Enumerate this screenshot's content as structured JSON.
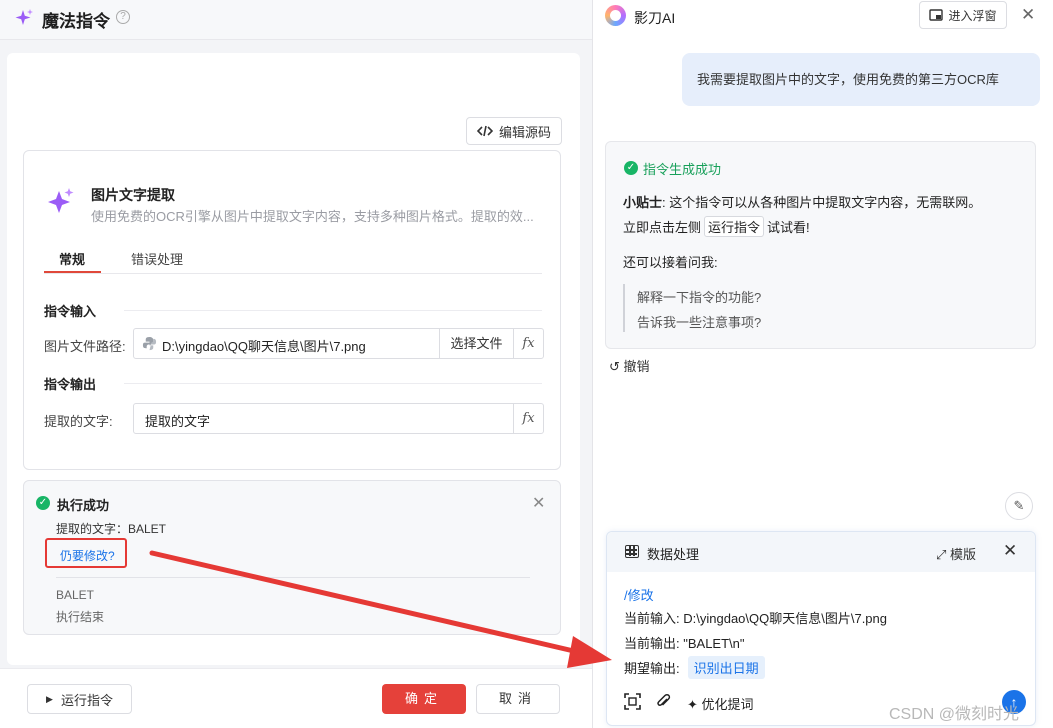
{
  "left": {
    "title": "魔法指令",
    "help_icon": "?",
    "edit_source_label": "编辑源码",
    "card": {
      "title": "图片文字提取",
      "desc": "使用免费的OCR引擎从图片中提取文字内容，支持多种图片格式。提取的效...",
      "tabs": [
        "常规",
        "错误处理"
      ],
      "active_tab": "常规",
      "input_section": "指令输入",
      "input_label": "图片文件路径:",
      "input_value": "D:\\yingdao\\QQ聊天信息\\图片\\7.png",
      "pick_file": "选择文件",
      "fx": "fx",
      "output_section": "指令输出",
      "output_label": "提取的文字:",
      "output_value": "提取的文字"
    },
    "result": {
      "title": "执行成功",
      "line1": "提取的文字：BALET",
      "modify_link": "仍要修改?",
      "log1": "BALET",
      "log2": "执行结束"
    },
    "footer": {
      "run_label": "运行指令",
      "ok_label": "确定",
      "cancel_label": "取消"
    }
  },
  "right": {
    "app_name": "影刀AI",
    "float_label": "进入浮窗",
    "user_message": "我需要提取图片中的文字，使用免费的第三方OCR库",
    "bot": {
      "status": "指令生成成功",
      "tip_prefix": "小贴士",
      "tip_text": ": 这个指令可以从各种图片中提取文字内容，无需联网。",
      "tip_line2_a": "立即点击左侧",
      "tip_line2_tag": "运行指令",
      "tip_line2_b": "试试看!",
      "ask": "还可以接着问我:",
      "q1": "解释一下指令的功能?",
      "q2": "告诉我一些注意事项?"
    },
    "undo_label": "撤销",
    "panel": {
      "title": "数据处理",
      "template_label": "模版",
      "cmd": "/修改",
      "cur_input_label": "当前输入:",
      "cur_input_value": "D:\\yingdao\\QQ聊天信息\\图片\\7.png",
      "cur_output_label": "当前输出:",
      "cur_output_value": "\"BALET\\n\"",
      "expected_label": "期望输出:",
      "expected_value": "识别出日期",
      "optimize_label": "优化提词"
    },
    "watermark": "CSDN @微刻时光"
  },
  "colors": {
    "accent_red": "#e5413a",
    "success_green": "#18b566",
    "link_blue": "#1a73e8",
    "annotation_red": "#e53935"
  }
}
